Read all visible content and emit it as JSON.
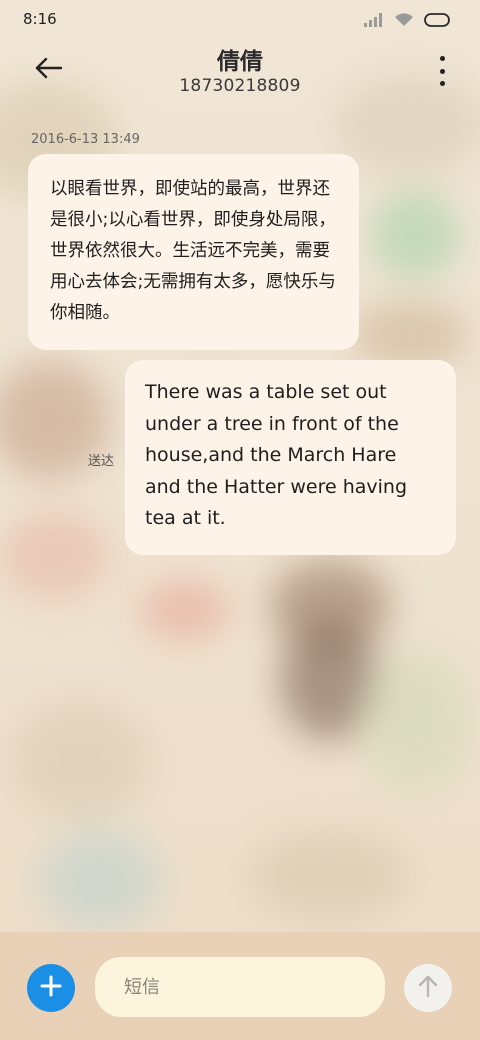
{
  "status_bar": {
    "time": "8:16",
    "icons": [
      "signal-icon",
      "wifi-icon",
      "battery-icon"
    ]
  },
  "header": {
    "back_icon": "back-arrow-icon",
    "contact_name": "倩倩",
    "contact_number": "18730218809",
    "more_icon": "more-vertical-icon"
  },
  "conversation": {
    "timestamp": "2016-6-13 13:49",
    "messages": [
      {
        "direction": "incoming",
        "text": "以眼看世界，即使站的最高，世界还是很小;以心看世界，即使身处局限，世界依然很大。生活远不完美，需要用心去体会;无需拥有太多，愿快乐与你相随。"
      },
      {
        "direction": "outgoing",
        "status": "送达",
        "text": "There was a table set out under a tree in front of the house,and the March Hare and the Hatter were having tea at it."
      }
    ]
  },
  "composer": {
    "add_icon": "plus-icon",
    "placeholder": "短信",
    "value": "",
    "send_icon": "send-arrow-up-icon"
  },
  "colors": {
    "bubble": "#fdf3e8",
    "compose_bar": "#e8d1b6",
    "input_bg": "#fcf4dd",
    "add_button": "#1b8fe6",
    "send_button": "#f3f1ee"
  }
}
